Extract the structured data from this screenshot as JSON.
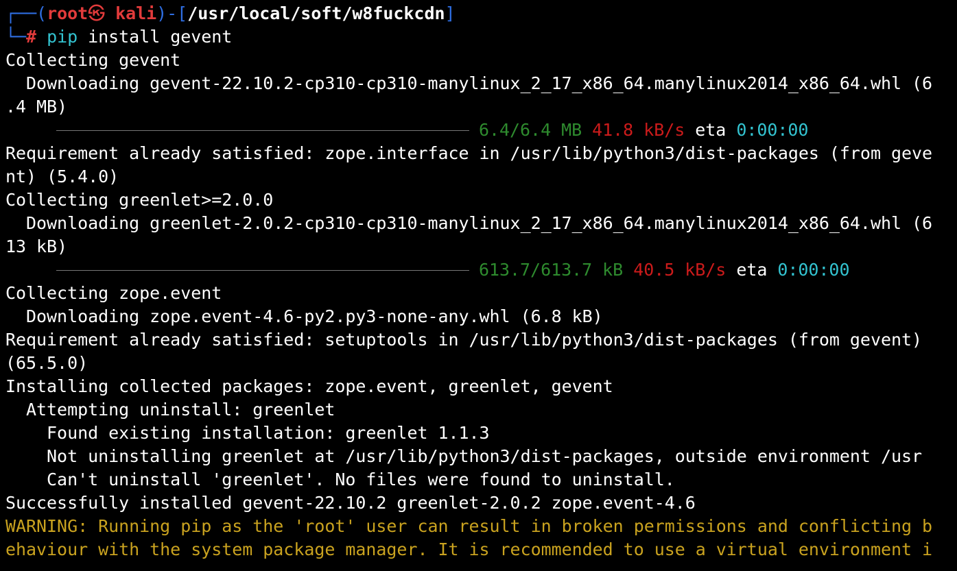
{
  "prompt": {
    "corner_top": "┌──",
    "open": "(",
    "user": "root",
    "at": "㉿",
    "host": "kali",
    "close": ")",
    "dash": "-",
    "lbracket": "[",
    "path": "/usr/local/soft/w8fuckcdn",
    "rbracket": "]",
    "corner_bottom": "└─",
    "hash": "#",
    "cmd_name": "pip",
    "cmd_args": " install gevent"
  },
  "lines": {
    "l3": "Collecting gevent",
    "l4": "  Downloading gevent-22.10.2-cp310-cp310-manylinux_2_17_x86_64.manylinux2014_x86_64.whl (6",
    "l5": ".4 MB)",
    "l7": "Requirement already satisfied: zope.interface in /usr/lib/python3/dist-packages (from geve",
    "l8": "nt) (5.4.0)",
    "l9": "Collecting greenlet>=2.0.0",
    "l10": "  Downloading greenlet-2.0.2-cp310-cp310-manylinux_2_17_x86_64.manylinux2014_x86_64.whl (6",
    "l11": "13 kB)",
    "l13": "Collecting zope.event",
    "l14": "  Downloading zope.event-4.6-py2.py3-none-any.whl (6.8 kB)",
    "l15": "Requirement already satisfied: setuptools in /usr/lib/python3/dist-packages (from gevent)",
    "l16": "(65.5.0)",
    "l17": "Installing collected packages: zope.event, greenlet, gevent",
    "l18": "  Attempting uninstall: greenlet",
    "l19": "    Found existing installation: greenlet 1.1.3",
    "l20": "    Not uninstalling greenlet at /usr/lib/python3/dist-packages, outside environment /usr",
    "l21": "    Can't uninstall 'greenlet'. No files were found to uninstall.",
    "l22": "Successfully installed gevent-22.10.2 greenlet-2.0.2 zope.event-4.6",
    "l23": "WARNING: Running pip as the 'root' user can result in broken permissions and conflicting b",
    "l24": "ehaviour with the system package manager. It is recommended to use a virtual environment i"
  },
  "progress1": {
    "size": "6.4/6.4 MB",
    "speed": "41.8 kB/s",
    "eta_label": "eta",
    "eta": "0:00:00",
    "fraction": 1.0
  },
  "progress2": {
    "size": "613.7/613.7 kB",
    "speed": "40.5 kB/s",
    "eta_label": "eta",
    "eta": "0:00:00",
    "fraction": 1.0
  },
  "colors": {
    "background": "#000000",
    "prompt_frame": "#2f6fe4",
    "prompt_user": "#e23b3b",
    "command": "#33c3d0",
    "progress_size": "#2e8b2e",
    "progress_speed": "#cc1b1b",
    "progress_eta": "#33c3d0",
    "warning": "#c9a21f"
  }
}
